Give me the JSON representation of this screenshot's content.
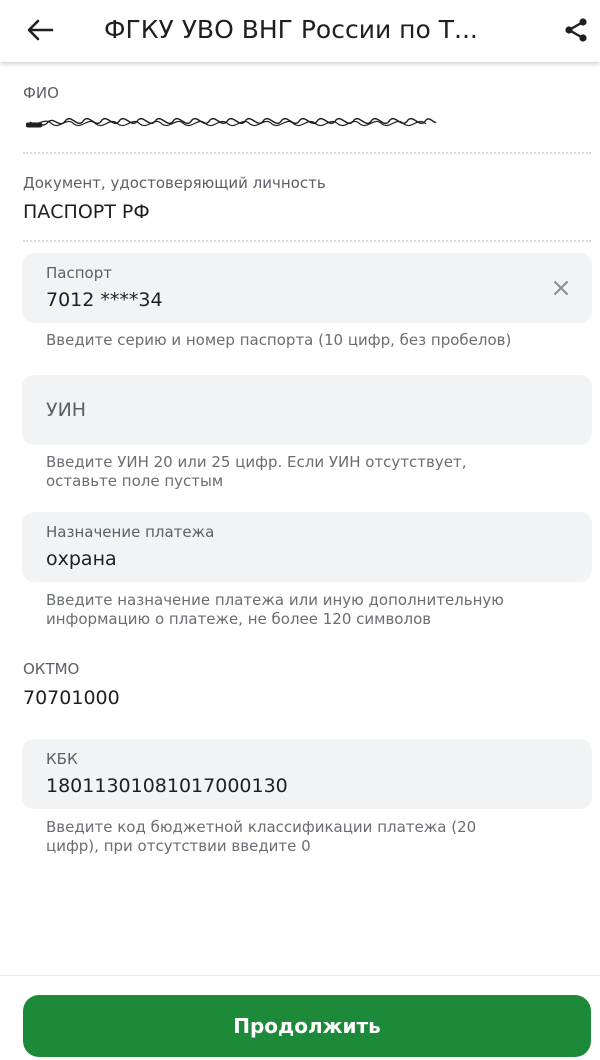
{
  "header": {
    "title": "ФГКУ УВО ВНГ России по Т...",
    "back_icon": "arrow-left-icon",
    "share_icon": "share-icon"
  },
  "fio": {
    "label": "ФИО"
  },
  "document": {
    "label": "Документ, удостоверяющий личность",
    "value": "ПАСПОРТ РФ"
  },
  "passport": {
    "label": "Паспорт",
    "value": "7012 ****34",
    "helper": "Введите серию и номер паспорта (10 цифр, без пробелов)"
  },
  "uin": {
    "placeholder": "УИН",
    "helper_line1": "Введите УИН 20 или 25 цифр. Если УИН отсутствует,",
    "helper_line2": "оставьте поле пустым"
  },
  "purpose": {
    "label": "Назначение платежа",
    "value": "охрана",
    "helper_line1": "Введите назначение платежа или иную дополнительную",
    "helper_line2": "информацию о платеже, не более 120 символов"
  },
  "oktmo": {
    "label": "ОКТМО",
    "value": "70701000"
  },
  "kbk": {
    "label": "КБК",
    "value": "18011301081017000130",
    "helper_line1": "Введите код бюджетной классификации платежа (20",
    "helper_line2": "цифр), при отсутствии введите 0"
  },
  "footer": {
    "continue_label": "Продолжить"
  },
  "colors": {
    "accent": "#1d8a3a",
    "field_bg": "#f2f3f5",
    "label": "#5c5f66"
  }
}
